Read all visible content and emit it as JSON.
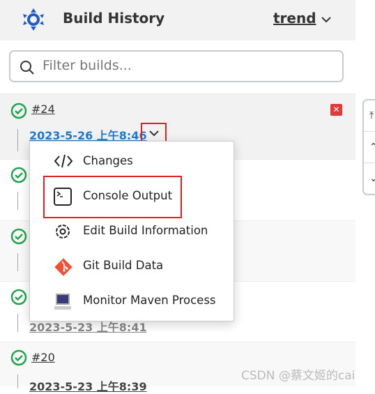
{
  "header": {
    "title": "Build History",
    "trend_label": "trend"
  },
  "search": {
    "placeholder": "Filter builds..."
  },
  "builds": [
    {
      "number": "#24",
      "date": "2023-5-26 上午8:46",
      "status": "success"
    },
    {
      "number": "",
      "date": "",
      "status": "success"
    },
    {
      "number": "",
      "date": "",
      "status": "success"
    },
    {
      "number": "",
      "date": "2023-5-23 上午8:41",
      "status": "success"
    },
    {
      "number": "#20",
      "date": "2023-5-23 上午8:39",
      "status": "success"
    }
  ],
  "menu": {
    "items": [
      {
        "label": "Changes",
        "icon": "code-icon"
      },
      {
        "label": "Console Output",
        "icon": "terminal-icon"
      },
      {
        "label": "Edit Build Information",
        "icon": "gear-icon"
      },
      {
        "label": "Git Build Data",
        "icon": "git-icon"
      },
      {
        "label": "Monitor Maven Process",
        "icon": "computer-icon"
      }
    ]
  },
  "watermark": "CSDN @蔡文姬的cai",
  "colors": {
    "link": "#1f7ad0",
    "success": "#1ea54a",
    "highlight": "#e02020",
    "header_bg": "#f2f2f2"
  }
}
